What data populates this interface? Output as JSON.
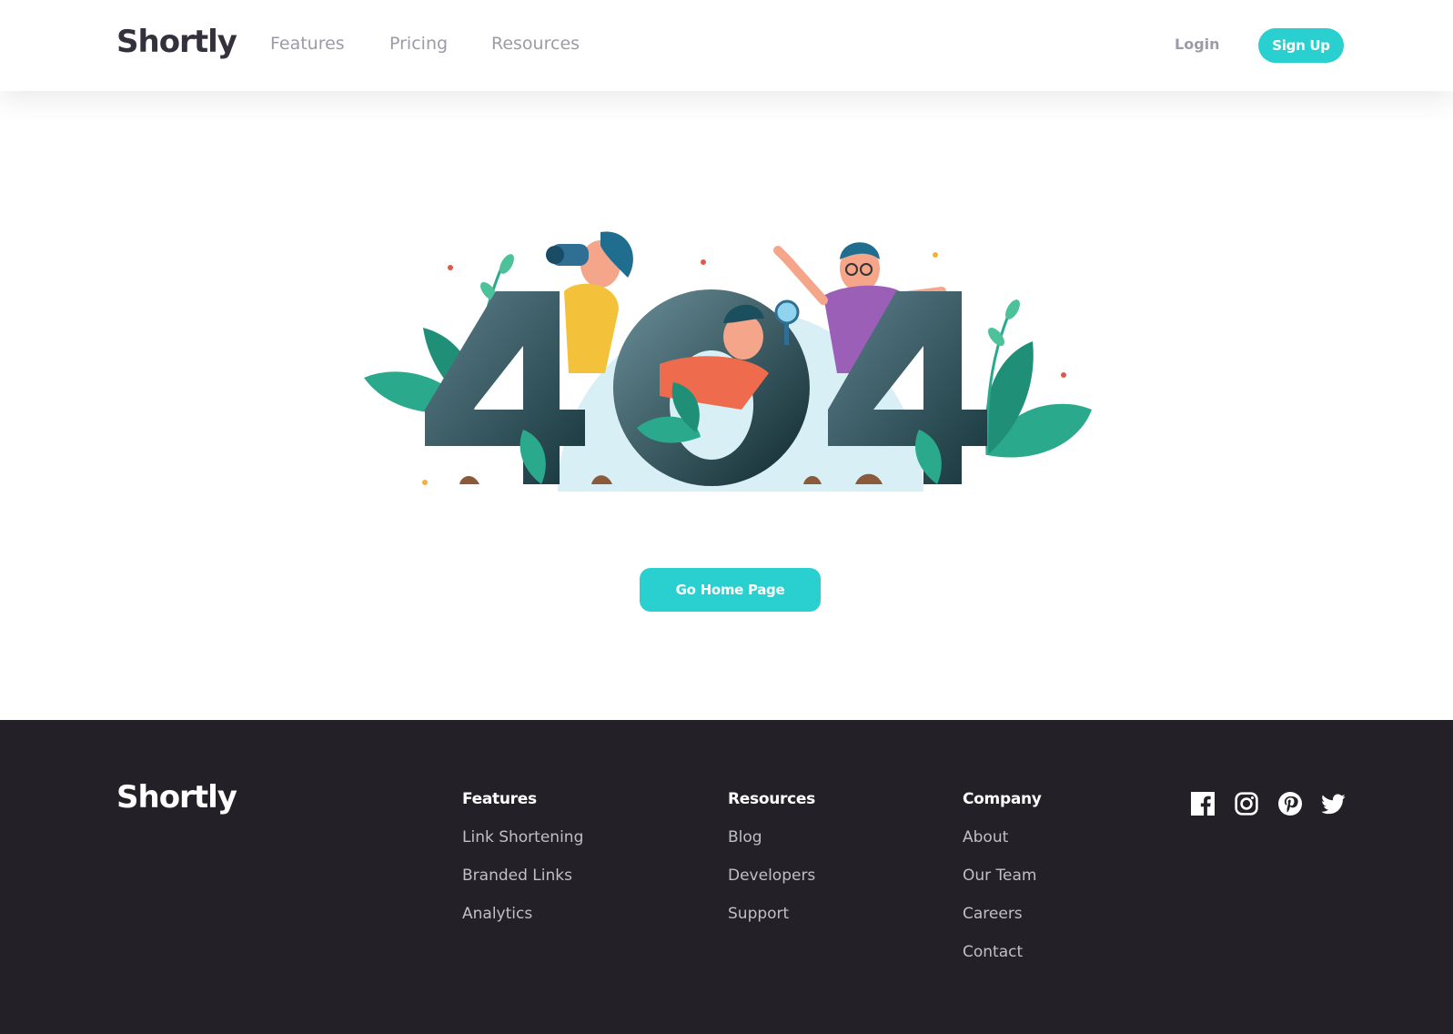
{
  "header": {
    "logo": "Shortly",
    "nav": [
      "Features",
      "Pricing",
      "Resources"
    ],
    "login_label": "Login",
    "signup_label": "Sign Up"
  },
  "main": {
    "illustration_text": "404",
    "home_button_label": "Go Home Page"
  },
  "footer": {
    "logo": "Shortly",
    "columns": [
      {
        "title": "Features",
        "links": [
          "Link Shortening",
          "Branded Links",
          "Analytics"
        ]
      },
      {
        "title": "Resources",
        "links": [
          "Blog",
          "Developers",
          "Support"
        ]
      },
      {
        "title": "Company",
        "links": [
          "About",
          "Our Team",
          "Careers",
          "Contact"
        ]
      }
    ],
    "social_icons": [
      "facebook-icon",
      "instagram-icon",
      "pinterest-icon",
      "twitter-icon"
    ]
  },
  "colors": {
    "accent": "#2acfcf",
    "dark": "#232127",
    "muted": "#9e9aa8",
    "footer_link": "#bfbfc6"
  }
}
